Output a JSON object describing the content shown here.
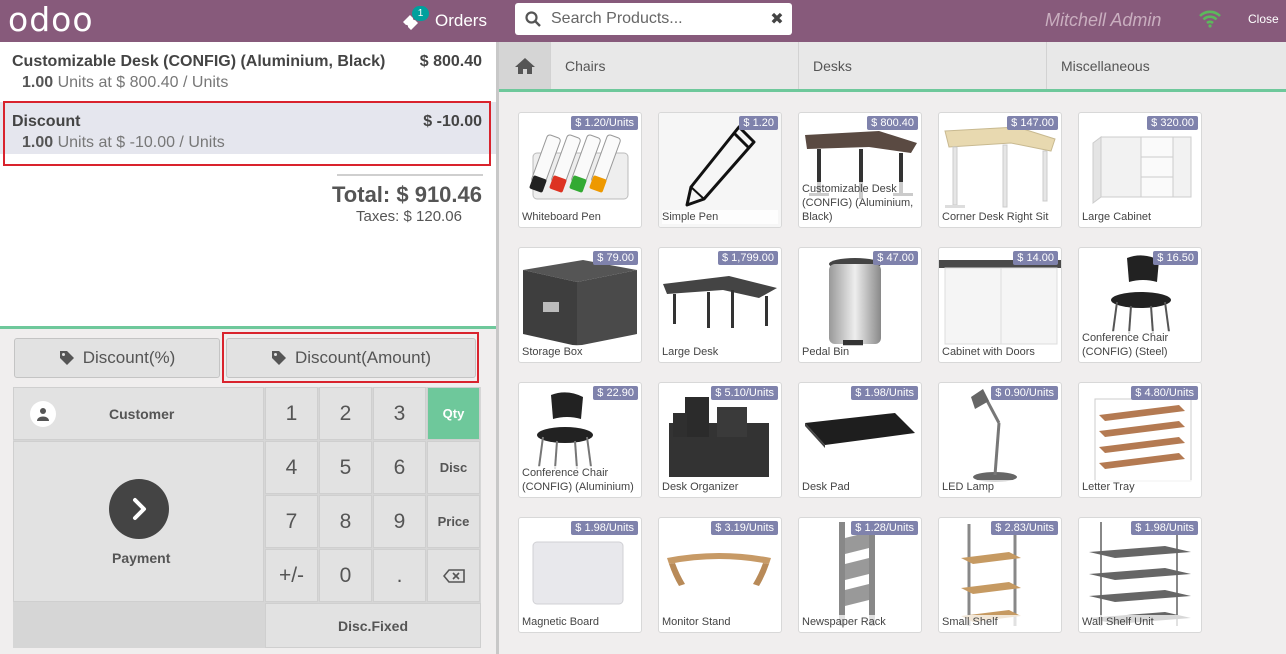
{
  "header": {
    "logo": "odoo",
    "orders_label": "Orders",
    "orders_count": "1",
    "search_placeholder": "Search Products...",
    "user": "Mitchell Admin",
    "close_label": "Close",
    "colors": {
      "brand": "#875a7b",
      "accent": "#00a09d",
      "wifi": "#5cb85c"
    }
  },
  "order": {
    "lines": [
      {
        "name": "Customizable Desk (CONFIG) (Aluminium, Black)",
        "price": "$ 800.40",
        "qty": "1.00",
        "info": " Units at $ 800.40 / Units"
      },
      {
        "name": "Discount",
        "price": "$ -10.00",
        "qty": "1.00",
        "info": " Units at $ -10.00 / Units"
      }
    ],
    "total": "Total: $ 910.46",
    "taxes": "Taxes: $ 120.06"
  },
  "actions": {
    "discount_pct": "Discount(%)",
    "discount_amount": "Discount(Amount)"
  },
  "numpad": {
    "customer": "Customer",
    "payment": "Payment",
    "keys": [
      "1",
      "2",
      "3",
      "4",
      "5",
      "6",
      "7",
      "8",
      "9",
      "+/-",
      "0",
      "."
    ],
    "modes": {
      "qty": "Qty",
      "disc": "Disc",
      "price": "Price"
    },
    "disc_fixed": "Disc.Fixed"
  },
  "categories": [
    "Chairs",
    "Desks",
    "Miscellaneous"
  ],
  "products": [
    {
      "name": "Whiteboard Pen",
      "price": "$ 1.20/Units",
      "icon": "whiteboard-pen"
    },
    {
      "name": "Simple Pen",
      "price": "$ 1.20",
      "icon": "pencil"
    },
    {
      "name": "Customizable Desk (CONFIG) (Aluminium, Black)",
      "price": "$ 800.40",
      "icon": "desk"
    },
    {
      "name": "Corner Desk Right Sit",
      "price": "$ 147.00",
      "icon": "corner-desk"
    },
    {
      "name": "Large Cabinet",
      "price": "$ 320.00",
      "icon": "cabinet"
    },
    {
      "name": "Storage Box",
      "price": "$ 79.00",
      "icon": "storage-box"
    },
    {
      "name": "Large Desk",
      "price": "$ 1,799.00",
      "icon": "large-desk"
    },
    {
      "name": "Pedal Bin",
      "price": "$ 47.00",
      "icon": "pedal-bin"
    },
    {
      "name": "Cabinet with Doors",
      "price": "$ 14.00",
      "icon": "cabinet-doors"
    },
    {
      "name": "Conference Chair (CONFIG) (Steel)",
      "price": "$ 16.50",
      "icon": "chair"
    },
    {
      "name": "Conference Chair (CONFIG) (Aluminium)",
      "price": "$ 22.90",
      "icon": "chair"
    },
    {
      "name": "Desk Organizer",
      "price": "$ 5.10/Units",
      "icon": "organizer"
    },
    {
      "name": "Desk Pad",
      "price": "$ 1.98/Units",
      "icon": "desk-pad"
    },
    {
      "name": "LED Lamp",
      "price": "$ 0.90/Units",
      "icon": "lamp"
    },
    {
      "name": "Letter Tray",
      "price": "$ 4.80/Units",
      "icon": "letter-tray"
    },
    {
      "name": "Magnetic Board",
      "price": "$ 1.98/Units",
      "icon": "board"
    },
    {
      "name": "Monitor Stand",
      "price": "$ 3.19/Units",
      "icon": "monitor-stand"
    },
    {
      "name": "Newspaper Rack",
      "price": "$ 1.28/Units",
      "icon": "rack"
    },
    {
      "name": "Small Shelf",
      "price": "$ 2.83/Units",
      "icon": "small-shelf"
    },
    {
      "name": "Wall Shelf Unit",
      "price": "$ 1.98/Units",
      "icon": "wall-shelf"
    }
  ]
}
